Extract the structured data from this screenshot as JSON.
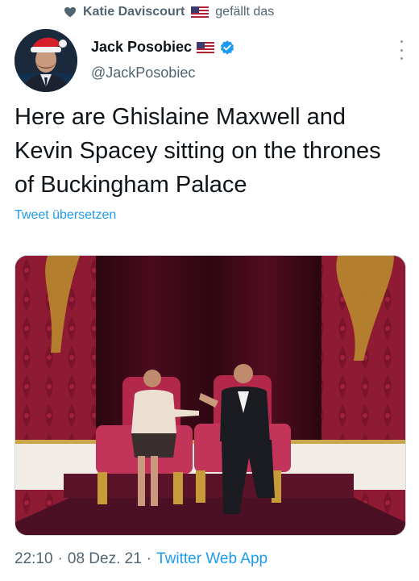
{
  "social_context": {
    "user": "Katie Daviscourt",
    "verb": "gefällt das"
  },
  "author": {
    "name": "Jack Posobiec",
    "handle": "@JackPosobiec"
  },
  "tweet": {
    "text": "Here are Ghislaine Maxwell and Kevin Spacey sitting on the thrones of Buckingham Palace",
    "translate_link": "Tweet übersetzen"
  },
  "meta": {
    "time": "22:10",
    "sep1": "·",
    "date": "08 Dez. 21",
    "sep2": "·",
    "app": "Twitter Web App"
  },
  "colors": {
    "accent": "#1d9bf0",
    "secondary_text": "#536471"
  },
  "icons": [
    "heart-icon",
    "us-flag-icon",
    "verified-badge-icon",
    "more-options-icon"
  ]
}
